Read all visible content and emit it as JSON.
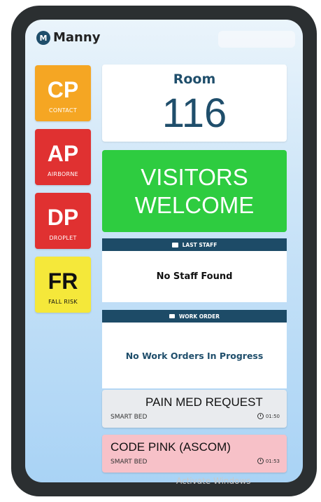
{
  "app": {
    "logo_letter": "M",
    "name": "Manny"
  },
  "precautions": [
    {
      "code": "CP",
      "label": "CONTACT",
      "color": "#f5a623"
    },
    {
      "code": "AP",
      "label": "AIRBORNE",
      "color": "#e03131"
    },
    {
      "code": "DP",
      "label": "DROPLET",
      "color": "#e03131"
    },
    {
      "code": "FR",
      "label": "FALL RISK",
      "color": "#f5e83a"
    }
  ],
  "room": {
    "label": "Room",
    "number": "116"
  },
  "visitors": {
    "line1": "VISITORS",
    "line2": "WELCOME",
    "color": "#2ecc40"
  },
  "last_staff": {
    "header": "LAST STAFF",
    "icon": "id-card-icon",
    "message": "No Staff Found"
  },
  "work_order": {
    "header": "WORK ORDER",
    "icon": "briefcase-icon",
    "message": "No Work Orders In Progress"
  },
  "alerts": [
    {
      "title": "PAIN MED REQUEST",
      "source": "SMART BED",
      "time": "01:50",
      "color": "#e9ebee"
    },
    {
      "title": "CODE PINK (ASCOM)",
      "source": "SMART BED",
      "time": "01:53",
      "color": "#f7c1c8"
    }
  ],
  "watermark": "Activate Windows"
}
